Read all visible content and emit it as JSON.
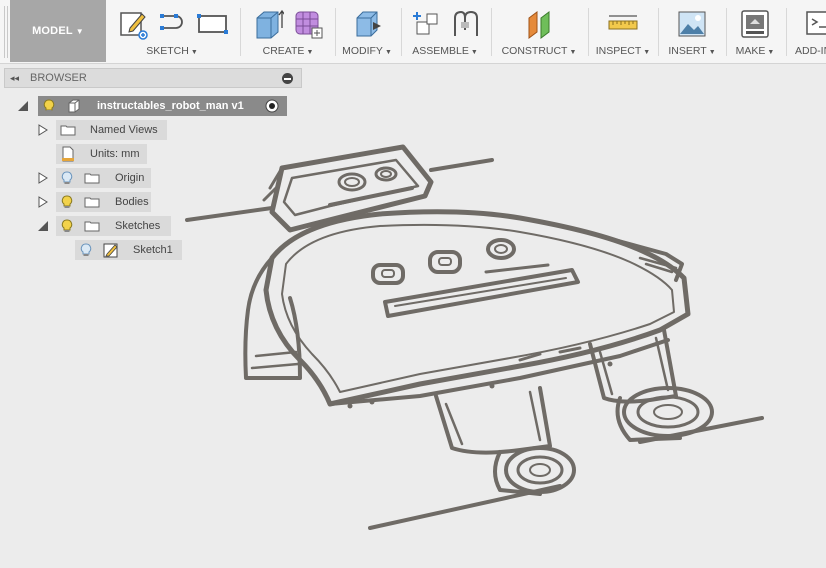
{
  "toolbar": {
    "workspace": {
      "label": "MODEL",
      "icon": "dropdown-caret"
    },
    "groups": [
      {
        "id": "sketch",
        "label": "SKETCH",
        "icons": [
          "create-sketch-icon",
          "line-arc-icon",
          "rectangle-icon"
        ]
      },
      {
        "id": "create",
        "label": "CREATE",
        "icons": [
          "extrude-box-icon",
          "form-sphere-icon"
        ]
      },
      {
        "id": "modify",
        "label": "MODIFY",
        "icons": [
          "press-pull-icon"
        ]
      },
      {
        "id": "assemble",
        "label": "ASSEMBLE",
        "icons": [
          "new-component-icon",
          "joint-icon"
        ]
      },
      {
        "id": "construct",
        "label": "CONSTRUCT",
        "icons": [
          "offset-plane-icon"
        ]
      },
      {
        "id": "inspect",
        "label": "INSPECT",
        "icons": [
          "measure-icon"
        ]
      },
      {
        "id": "insert",
        "label": "INSERT",
        "icons": [
          "insert-image-icon"
        ]
      },
      {
        "id": "make",
        "label": "MAKE",
        "icons": [
          "3d-print-icon"
        ]
      },
      {
        "id": "addins",
        "label": "ADD-INS",
        "icons": [
          "scripts-icon"
        ]
      }
    ]
  },
  "browser": {
    "title": "BROWSER",
    "collapse_icon": "double-left-arrow-icon",
    "tree": {
      "root": {
        "label": "instructables_robot_man v1",
        "expanded": true,
        "visible": true
      },
      "named_views": {
        "label": "Named Views",
        "expanded": false
      },
      "units": {
        "label": "Units: mm"
      },
      "origin": {
        "label": "Origin",
        "expanded": false,
        "visible": true
      },
      "bodies": {
        "label": "Bodies",
        "expanded": false,
        "visible": true
      },
      "sketches": {
        "label": "Sketches",
        "expanded": true,
        "visible": true
      },
      "sketch1": {
        "label": "Sketch1",
        "visible": false
      }
    }
  },
  "viewport": {
    "model_color": "#6f6b66",
    "background": "#ececec"
  },
  "colors": {
    "toolbar_bg": "#f5f5f5",
    "workspace_bg": "#a7a7a7",
    "bulb_on": "#f2d24a",
    "bulb_off": "#9fc3e0"
  }
}
